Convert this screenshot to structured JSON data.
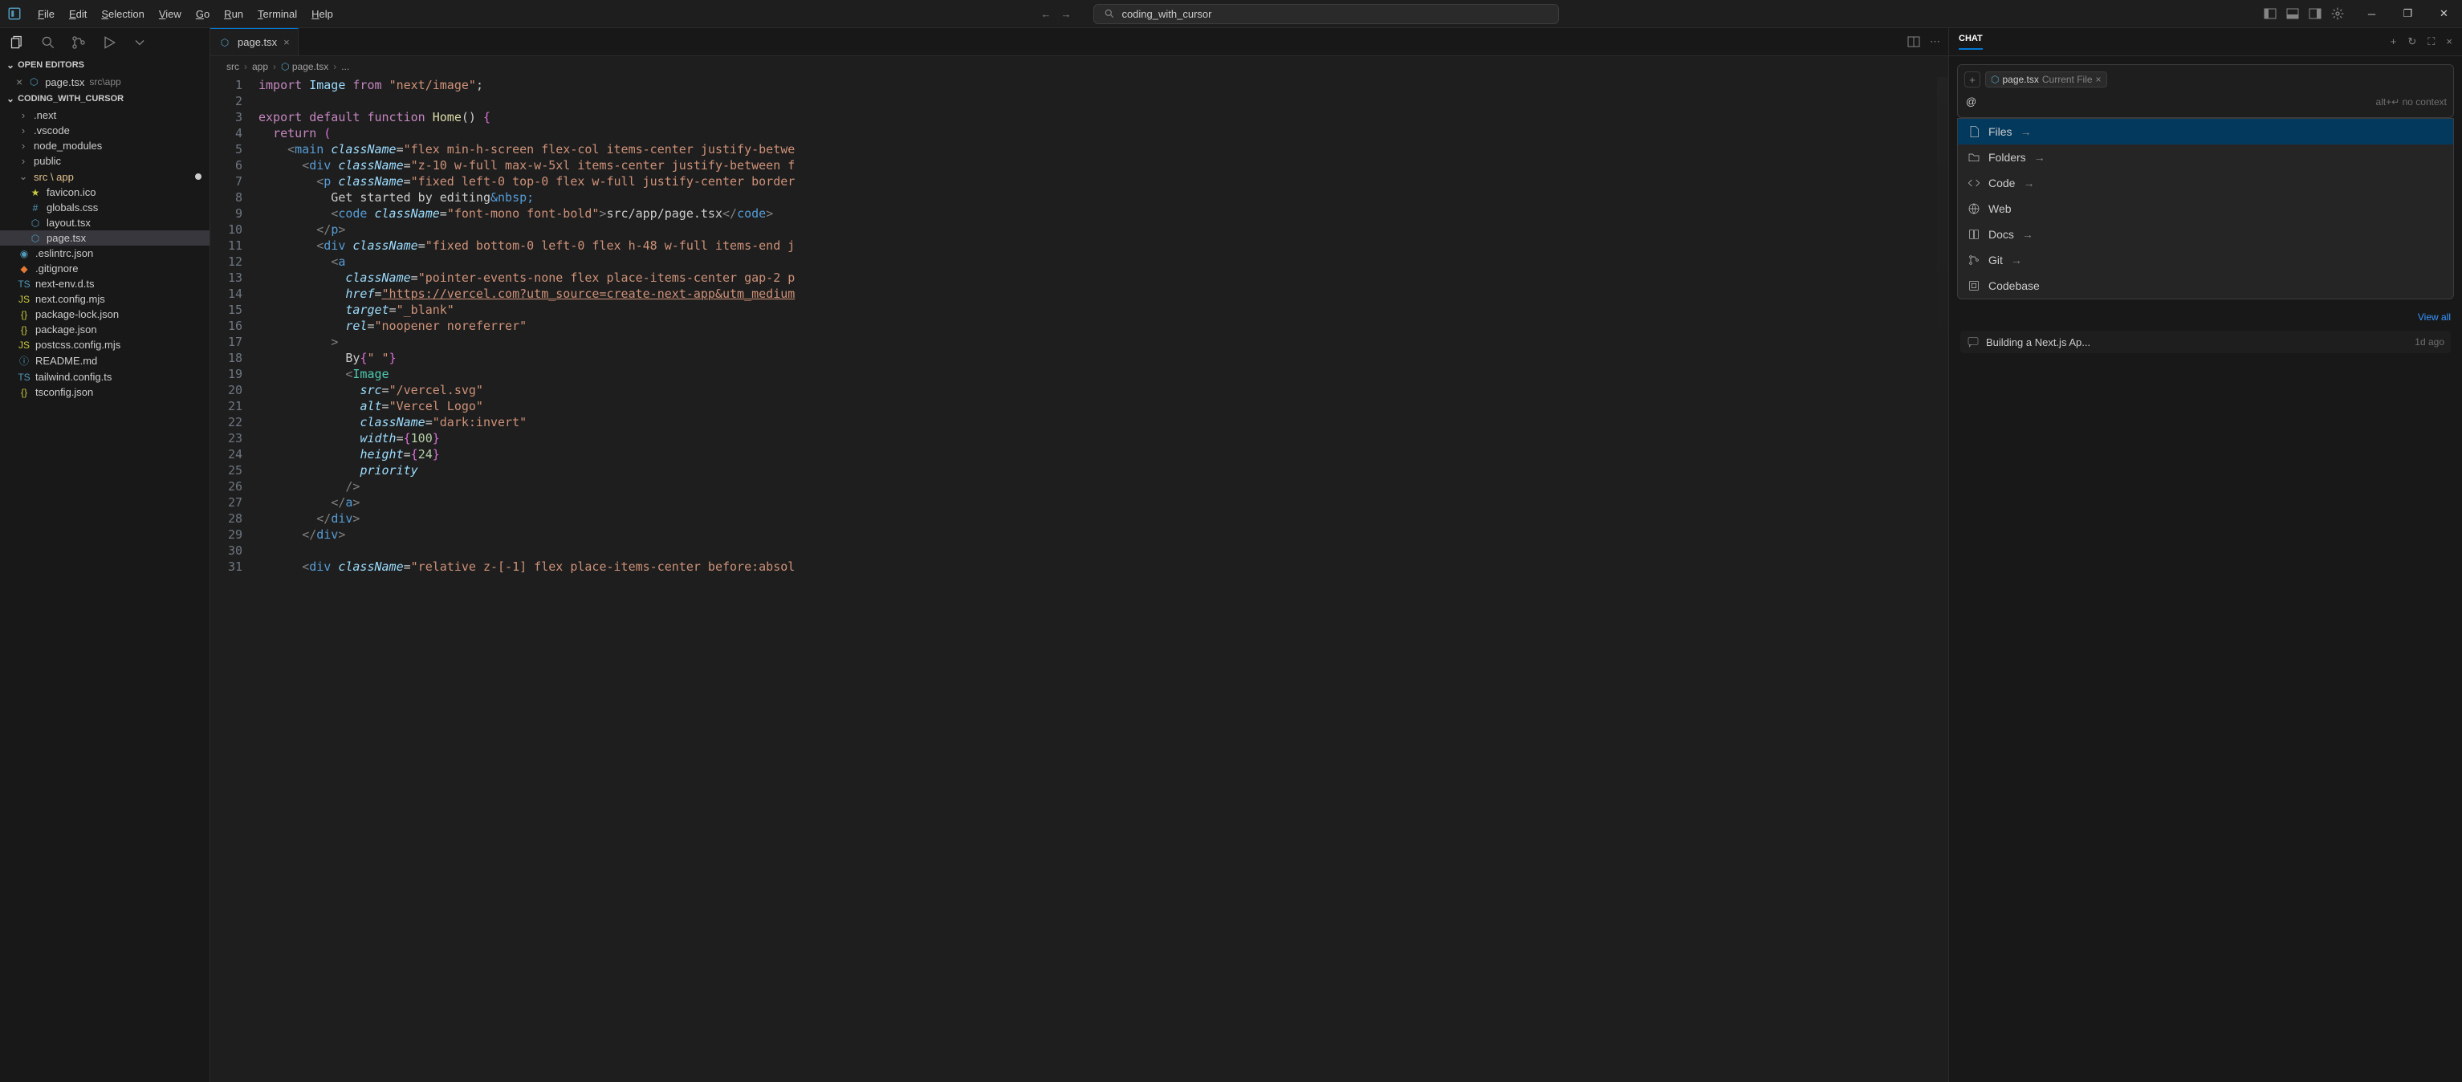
{
  "menu": [
    "File",
    "Edit",
    "Selection",
    "View",
    "Go",
    "Run",
    "Terminal",
    "Help"
  ],
  "search_placeholder": "coding_with_cursor",
  "sidebar": {
    "open_editors_label": "OPEN EDITORS",
    "open_editor": {
      "name": "page.tsx",
      "path": "src\\app"
    },
    "workspace_label": "CODING_WITH_CURSOR",
    "tree": [
      {
        "type": "folder",
        "name": ".next",
        "depth": 0,
        "open": false
      },
      {
        "type": "folder",
        "name": ".vscode",
        "depth": 0,
        "open": false
      },
      {
        "type": "folder",
        "name": "node_modules",
        "depth": 0,
        "open": false
      },
      {
        "type": "folder",
        "name": "public",
        "depth": 0,
        "open": false
      },
      {
        "type": "folder",
        "name": "src \\ app",
        "depth": 0,
        "open": true,
        "highlight": true,
        "modified": true
      },
      {
        "type": "file",
        "name": "favicon.ico",
        "depth": 1,
        "icon": "fav"
      },
      {
        "type": "file",
        "name": "globals.css",
        "depth": 1,
        "icon": "css"
      },
      {
        "type": "file",
        "name": "layout.tsx",
        "depth": 1,
        "icon": "react"
      },
      {
        "type": "file",
        "name": "page.tsx",
        "depth": 1,
        "icon": "react",
        "active": true
      },
      {
        "type": "file",
        "name": ".eslintrc.json",
        "depth": 0,
        "icon": "eslint"
      },
      {
        "type": "file",
        "name": ".gitignore",
        "depth": 0,
        "icon": "git"
      },
      {
        "type": "file",
        "name": "next-env.d.ts",
        "depth": 0,
        "icon": "ts"
      },
      {
        "type": "file",
        "name": "next.config.mjs",
        "depth": 0,
        "icon": "js"
      },
      {
        "type": "file",
        "name": "package-lock.json",
        "depth": 0,
        "icon": "json"
      },
      {
        "type": "file",
        "name": "package.json",
        "depth": 0,
        "icon": "json"
      },
      {
        "type": "file",
        "name": "postcss.config.mjs",
        "depth": 0,
        "icon": "js"
      },
      {
        "type": "file",
        "name": "README.md",
        "depth": 0,
        "icon": "info"
      },
      {
        "type": "file",
        "name": "tailwind.config.ts",
        "depth": 0,
        "icon": "ts"
      },
      {
        "type": "file",
        "name": "tsconfig.json",
        "depth": 0,
        "icon": "json"
      }
    ]
  },
  "editor": {
    "tab_name": "page.tsx",
    "breadcrumb": [
      "src",
      "app",
      "page.tsx",
      "..."
    ],
    "code_lines": [
      {
        "n": 1,
        "html": "<span class='tok-kw'>import</span> <span class='tok-var'>Image</span> <span class='tok-kw'>from</span> <span class='tok-str'>\"next/image\"</span>;"
      },
      {
        "n": 2,
        "html": ""
      },
      {
        "n": 3,
        "html": "<span class='tok-kw'>export</span> <span class='tok-kw'>default</span> <span class='tok-kw'>function</span> <span class='tok-fn'>Home</span>() <span class='tok-brace'>{</span>"
      },
      {
        "n": 4,
        "html": "  <span class='tok-kw'>return</span> <span class='tok-brace'>(</span>"
      },
      {
        "n": 5,
        "html": "    <span class='tok-punc'>&lt;</span><span class='tok-tag'>main</span> <span class='tok-attr'>className</span>=<span class='tok-str'>\"flex min-h-screen flex-col items-center justify-betwe</span>"
      },
      {
        "n": 6,
        "html": "      <span class='tok-punc'>&lt;</span><span class='tok-tag'>div</span> <span class='tok-attr'>className</span>=<span class='tok-str'>\"z-10 w-full max-w-5xl items-center justify-between f</span>"
      },
      {
        "n": 7,
        "html": "        <span class='tok-punc'>&lt;</span><span class='tok-tag'>p</span> <span class='tok-attr'>className</span>=<span class='tok-str'>\"fixed left-0 top-0 flex w-full justify-center border</span>"
      },
      {
        "n": 8,
        "html": "          Get started by editing<span class='tok-tag'>&amp;nbsp;</span>"
      },
      {
        "n": 9,
        "html": "          <span class='tok-punc'>&lt;</span><span class='tok-tag'>code</span> <span class='tok-attr'>className</span>=<span class='tok-str'>\"font-mono font-bold\"</span><span class='tok-punc'>&gt;</span>src/app/page.tsx<span class='tok-punc'>&lt;/</span><span class='tok-tag'>code</span><span class='tok-punc'>&gt;</span>"
      },
      {
        "n": 10,
        "html": "        <span class='tok-punc'>&lt;/</span><span class='tok-tag'>p</span><span class='tok-punc'>&gt;</span>"
      },
      {
        "n": 11,
        "html": "        <span class='tok-punc'>&lt;</span><span class='tok-tag'>div</span> <span class='tok-attr'>className</span>=<span class='tok-str'>\"fixed bottom-0 left-0 flex h-48 w-full items-end j</span>"
      },
      {
        "n": 12,
        "html": "          <span class='tok-punc'>&lt;</span><span class='tok-tag'>a</span>"
      },
      {
        "n": 13,
        "html": "            <span class='tok-attr'>className</span>=<span class='tok-str'>\"pointer-events-none flex place-items-center gap-2 p</span>"
      },
      {
        "n": 14,
        "html": "            <span class='tok-attr'>href</span>=<span class='tok-url'>\"https://vercel.com?utm_source=create-next-app&amp;utm_medium</span>"
      },
      {
        "n": 15,
        "html": "            <span class='tok-attr'>target</span>=<span class='tok-str'>\"_blank\"</span>"
      },
      {
        "n": 16,
        "html": "            <span class='tok-attr'>rel</span>=<span class='tok-str'>\"noopener noreferrer\"</span>"
      },
      {
        "n": 17,
        "html": "          <span class='tok-punc'>&gt;</span>"
      },
      {
        "n": 18,
        "html": "            By<span class='tok-brace'>{</span><span class='tok-str'>\" \"</span><span class='tok-brace'>}</span>"
      },
      {
        "n": 19,
        "html": "            <span class='tok-punc'>&lt;</span><span class='tok-type'>Image</span>"
      },
      {
        "n": 20,
        "html": "              <span class='tok-attr'>src</span>=<span class='tok-str'>\"/vercel.svg\"</span>"
      },
      {
        "n": 21,
        "html": "              <span class='tok-attr'>alt</span>=<span class='tok-str'>\"Vercel Logo\"</span>"
      },
      {
        "n": 22,
        "html": "              <span class='tok-attr'>className</span>=<span class='tok-str'>\"dark:invert\"</span>"
      },
      {
        "n": 23,
        "html": "              <span class='tok-attr'>width</span>=<span class='tok-brace'>{</span><span class='tok-num'>100</span><span class='tok-brace'>}</span>"
      },
      {
        "n": 24,
        "html": "              <span class='tok-attr'>height</span>=<span class='tok-brace'>{</span><span class='tok-num'>24</span><span class='tok-brace'>}</span>"
      },
      {
        "n": 25,
        "html": "              <span class='tok-attr'>priority</span>"
      },
      {
        "n": 26,
        "html": "            <span class='tok-punc'>/&gt;</span>"
      },
      {
        "n": 27,
        "html": "          <span class='tok-punc'>&lt;/</span><span class='tok-tag'>a</span><span class='tok-punc'>&gt;</span>"
      },
      {
        "n": 28,
        "html": "        <span class='tok-punc'>&lt;/</span><span class='tok-tag'>div</span><span class='tok-punc'>&gt;</span>"
      },
      {
        "n": 29,
        "html": "      <span class='tok-punc'>&lt;/</span><span class='tok-tag'>div</span><span class='tok-punc'>&gt;</span>"
      },
      {
        "n": 30,
        "html": ""
      },
      {
        "n": 31,
        "html": "      <span class='tok-punc'>&lt;</span><span class='tok-tag'>div</span> <span class='tok-attr'>className</span>=<span class='tok-str'>\"relative z-[-1] flex place-items-center before:absol</span>"
      }
    ]
  },
  "chat": {
    "title": "CHAT",
    "chip_file": "page.tsx",
    "chip_label": "Current File",
    "at": "@",
    "input_hint": "alt+↵ no context",
    "menu": [
      {
        "icon": "file",
        "label": "Files",
        "arrow": true,
        "selected": true
      },
      {
        "icon": "folder",
        "label": "Folders",
        "arrow": true
      },
      {
        "icon": "code",
        "label": "Code",
        "arrow": true
      },
      {
        "icon": "globe",
        "label": "Web"
      },
      {
        "icon": "book",
        "label": "Docs",
        "arrow": true
      },
      {
        "icon": "git",
        "label": "Git",
        "arrow": true
      },
      {
        "icon": "box",
        "label": "Codebase"
      }
    ],
    "view_all": "View all",
    "history": {
      "title": "Building a Next.js Ap...",
      "time": "1d ago"
    }
  }
}
